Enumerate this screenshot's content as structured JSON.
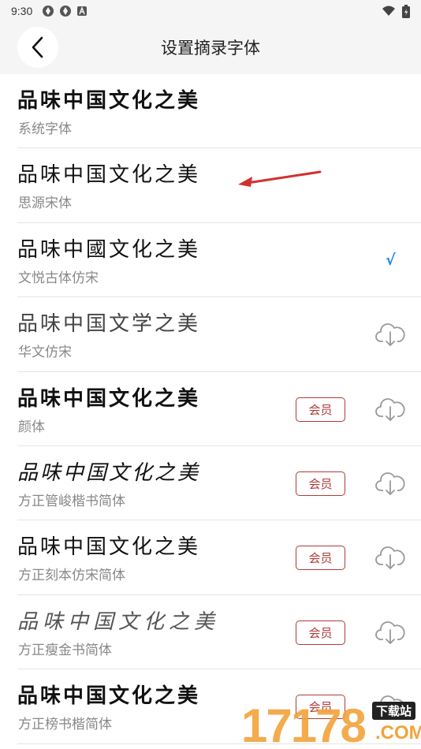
{
  "status_bar": {
    "time": "9:30"
  },
  "header": {
    "title": "设置摘录字体"
  },
  "fonts": [
    {
      "preview": "品味中国文化之美",
      "name": "系统字体",
      "state": "none",
      "style": "p-heavy"
    },
    {
      "preview": "品味中国文化之美",
      "name": "思源宋体",
      "state": "none",
      "style": "p-song"
    },
    {
      "preview": "品味中國文化之美",
      "name": "文悦古体仿宋",
      "state": "selected",
      "style": "p-serif"
    },
    {
      "preview": "品味中国文学之美",
      "name": "华文仿宋",
      "state": "download",
      "style": "p-thin"
    },
    {
      "preview": "品味中国文化之美",
      "name": "颜体",
      "state": "member",
      "style": "p-bold"
    },
    {
      "preview": "品味中国文化之美",
      "name": "方正管峻楷书简体",
      "state": "member",
      "style": "p-kai"
    },
    {
      "preview": "品味中国文化之美",
      "name": "方正刻本仿宋简体",
      "state": "member",
      "style": "p-serif"
    },
    {
      "preview": "品味中国文化之美",
      "name": "方正瘦金书简体",
      "state": "member",
      "style": "p-xthin"
    },
    {
      "preview": "品味中国文化之美",
      "name": "方正榜书楷简体",
      "state": "member",
      "style": "p-heavy"
    }
  ],
  "member_label": "会员",
  "check_mark": "√",
  "watermark": {
    "number": "17178",
    "tag": "下载站",
    "suffix": ".COM"
  },
  "colors": {
    "accent_check": "#1e88e5",
    "member_red": "#b03a3a",
    "arrow_red": "#d32f2f",
    "watermark_orange": "#f2a33a"
  }
}
